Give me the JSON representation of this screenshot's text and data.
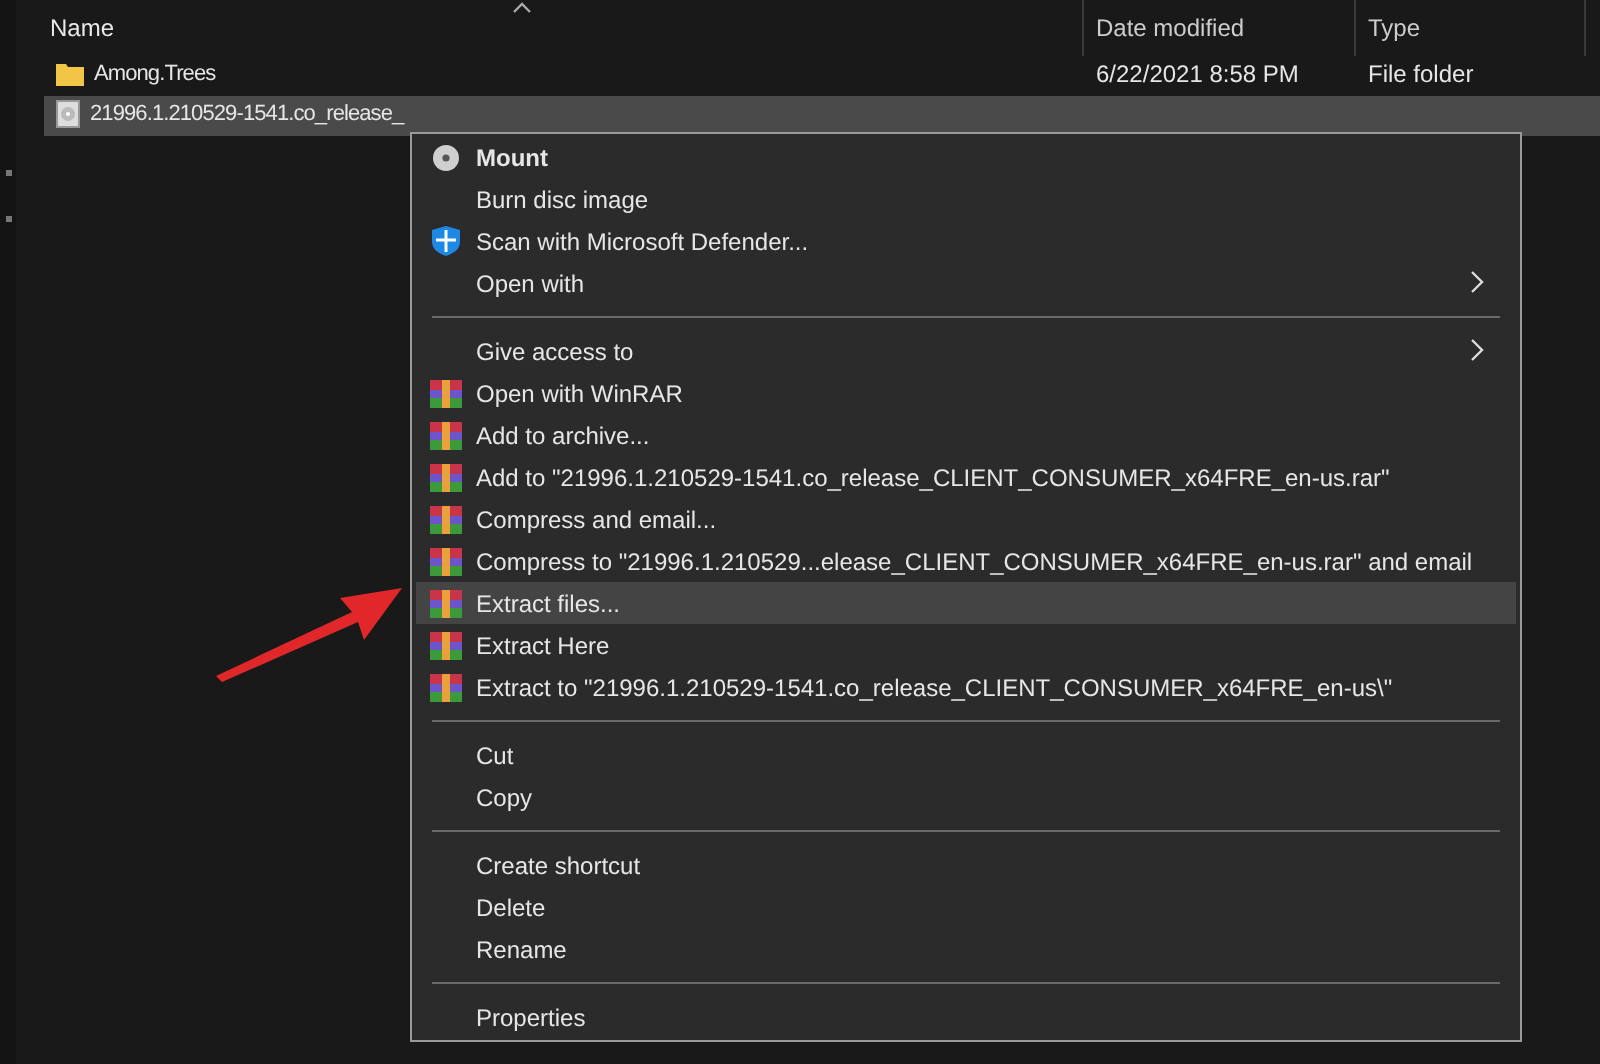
{
  "columns": [
    {
      "label": "Name",
      "sorted": true
    },
    {
      "label": "Date modified",
      "sorted": false
    },
    {
      "label": "Type",
      "sorted": false
    }
  ],
  "files": [
    {
      "kind": "folder",
      "name": "Among.Trees",
      "date": "6/22/2021 8:58 PM",
      "type": "File folder",
      "selected": false
    },
    {
      "kind": "disc",
      "name": "21996.1.210529-1541.co_release_",
      "selected": true
    }
  ],
  "context_menu": {
    "groups": [
      [
        {
          "label": "Mount",
          "kind": "disc",
          "bold": true,
          "submenu": false,
          "selected": false
        },
        {
          "label": "Burn disc image",
          "kind": "plain",
          "bold": false,
          "submenu": false,
          "selected": false
        },
        {
          "label": "Scan with Microsoft Defender...",
          "kind": "shield",
          "bold": false,
          "submenu": false,
          "selected": false
        },
        {
          "label": "Open with",
          "kind": "plain",
          "bold": false,
          "submenu": true,
          "selected": false
        }
      ],
      [
        {
          "label": "Give access to",
          "kind": "plain",
          "bold": false,
          "submenu": true,
          "selected": false
        },
        {
          "label": "Open with WinRAR",
          "kind": "archive",
          "bold": false,
          "submenu": false,
          "selected": false
        },
        {
          "label": "Add to archive...",
          "kind": "archive",
          "bold": false,
          "submenu": false,
          "selected": false
        },
        {
          "label": "Add to \"21996.1.210529-1541.co_release_CLIENT_CONSUMER_x64FRE_en-us.rar\"",
          "kind": "archive",
          "bold": false,
          "submenu": false,
          "selected": false
        },
        {
          "label": "Compress and email...",
          "kind": "archive",
          "bold": false,
          "submenu": false,
          "selected": false
        },
        {
          "label": "Compress to \"21996.1.210529...elease_CLIENT_CONSUMER_x64FRE_en-us.rar\" and email",
          "kind": "archive",
          "bold": false,
          "submenu": false,
          "selected": false
        },
        {
          "label": "Extract files...",
          "kind": "archive",
          "bold": false,
          "submenu": false,
          "selected": true
        },
        {
          "label": "Extract Here",
          "kind": "archive",
          "bold": false,
          "submenu": false,
          "selected": false
        },
        {
          "label": "Extract to \"21996.1.210529-1541.co_release_CLIENT_CONSUMER_x64FRE_en-us\\\"",
          "kind": "archive",
          "bold": false,
          "submenu": false,
          "selected": false
        }
      ],
      [
        {
          "label": "Cut",
          "kind": "plain",
          "bold": false,
          "submenu": false,
          "selected": false
        },
        {
          "label": "Copy",
          "kind": "plain",
          "bold": false,
          "submenu": false,
          "selected": false
        }
      ],
      [
        {
          "label": "Create shortcut",
          "kind": "plain",
          "bold": false,
          "submenu": false,
          "selected": false
        },
        {
          "label": "Delete",
          "kind": "plain",
          "bold": false,
          "submenu": false,
          "selected": false
        },
        {
          "label": "Rename",
          "kind": "plain",
          "bold": false,
          "submenu": false,
          "selected": false
        }
      ],
      [
        {
          "label": "Properties",
          "kind": "plain",
          "bold": false,
          "submenu": false,
          "selected": false
        }
      ]
    ]
  }
}
